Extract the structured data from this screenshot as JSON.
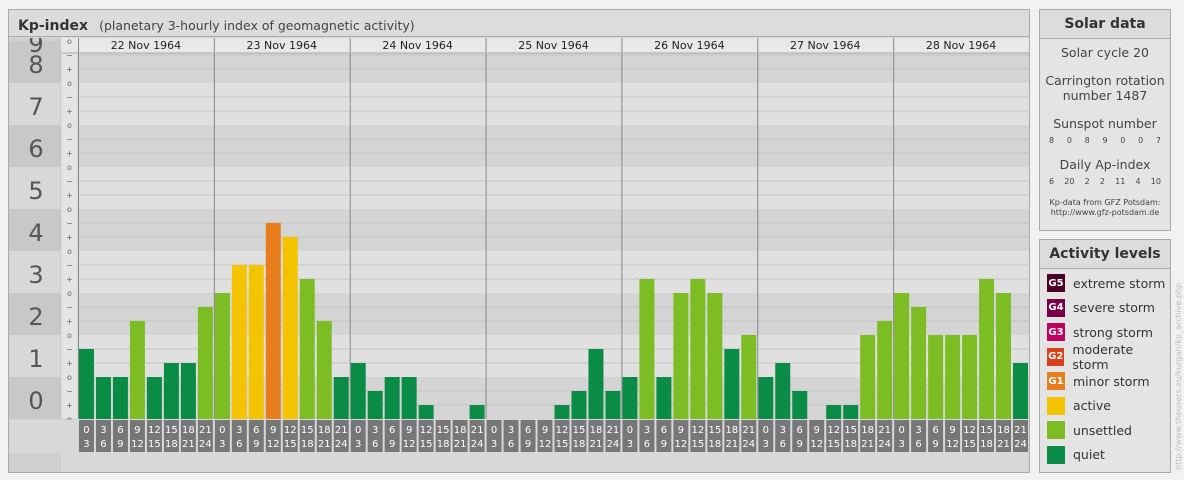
{
  "header": {
    "title": "Kp-index",
    "subtitle": "(planetary 3-hourly index of geomagnetic activity)"
  },
  "solar_data": {
    "title": "Solar data",
    "solar_cycle": "Solar cycle 20",
    "carrington_line1": "Carrington rotation",
    "carrington_line2": "number 1487",
    "sunspot_label": "Sunspot number",
    "sunspot_values": [
      "8",
      "0",
      "8",
      "9",
      "0",
      "0",
      "7"
    ],
    "ap_label": "Daily Ap-index",
    "ap_values": [
      "6",
      "20",
      "2",
      "2",
      "11",
      "4",
      "10"
    ],
    "source_line1": "Kp-data from GFZ Potsdam:",
    "source_line2": "http://www.gfz-potsdam.de"
  },
  "activity_levels": {
    "title": "Activity levels",
    "items": [
      {
        "badge": "G5",
        "label": "extreme storm",
        "color": "#4d0026"
      },
      {
        "badge": "G4",
        "label": "severe storm",
        "color": "#7a0047"
      },
      {
        "badge": "G3",
        "label": "strong storm",
        "color": "#c0005e"
      },
      {
        "badge": "G2",
        "label": "moderate storm",
        "color": "#d8401c"
      },
      {
        "badge": "G1",
        "label": "minor storm",
        "color": "#e87d1e"
      },
      {
        "badge": "",
        "label": "active",
        "color": "#f5c400"
      },
      {
        "badge": "",
        "label": "unsettled",
        "color": "#7dbd24"
      },
      {
        "badge": "",
        "label": "quiet",
        "color": "#0a8c46"
      }
    ]
  },
  "credit": "http://www.theusers.eu/kurgan/kp_archive.php",
  "chart_data": {
    "type": "bar",
    "title": "Kp-index",
    "subtitle": "(planetary 3-hourly index of geomagnetic activity)",
    "ylim": [
      0,
      9
    ],
    "y_ticks": [
      "0",
      "1",
      "2",
      "3",
      "4",
      "5",
      "6",
      "7",
      "8",
      "9"
    ],
    "minor_tick_labels": [
      "o",
      "+",
      "−"
    ],
    "days": [
      "22 Nov 1964",
      "23 Nov 1964",
      "24 Nov 1964",
      "25 Nov 1964",
      "26 Nov 1964",
      "27 Nov 1964",
      "28 Nov 1964"
    ],
    "interval_labels_top": [
      "0",
      "3",
      "6",
      "9",
      "12",
      "15",
      "18",
      "21"
    ],
    "interval_labels_bottom": [
      "3",
      "6",
      "9",
      "12",
      "15",
      "18",
      "21",
      "24"
    ],
    "kp_values": [
      1.667,
      1.0,
      1.0,
      2.333,
      1.0,
      1.333,
      1.333,
      2.667,
      3.0,
      3.667,
      3.667,
      4.667,
      4.333,
      3.333,
      2.333,
      1.0,
      1.333,
      0.667,
      1.0,
      1.0,
      0.333,
      0.0,
      0.0,
      0.333,
      0.0,
      0.0,
      0.0,
      0.0,
      0.333,
      0.667,
      1.667,
      0.667,
      1.0,
      3.333,
      1.0,
      3.0,
      3.333,
      3.0,
      1.667,
      2.0,
      1.0,
      1.333,
      0.667,
      0.0,
      0.333,
      0.333,
      2.0,
      2.333,
      3.0,
      2.667,
      2.0,
      2.0,
      2.0,
      3.333,
      3.0,
      1.333
    ],
    "level_colors": {
      "quiet": "#0a8c46",
      "unsettled": "#7dbd24",
      "active": "#f5c400",
      "g1": "#e87d1e"
    }
  }
}
